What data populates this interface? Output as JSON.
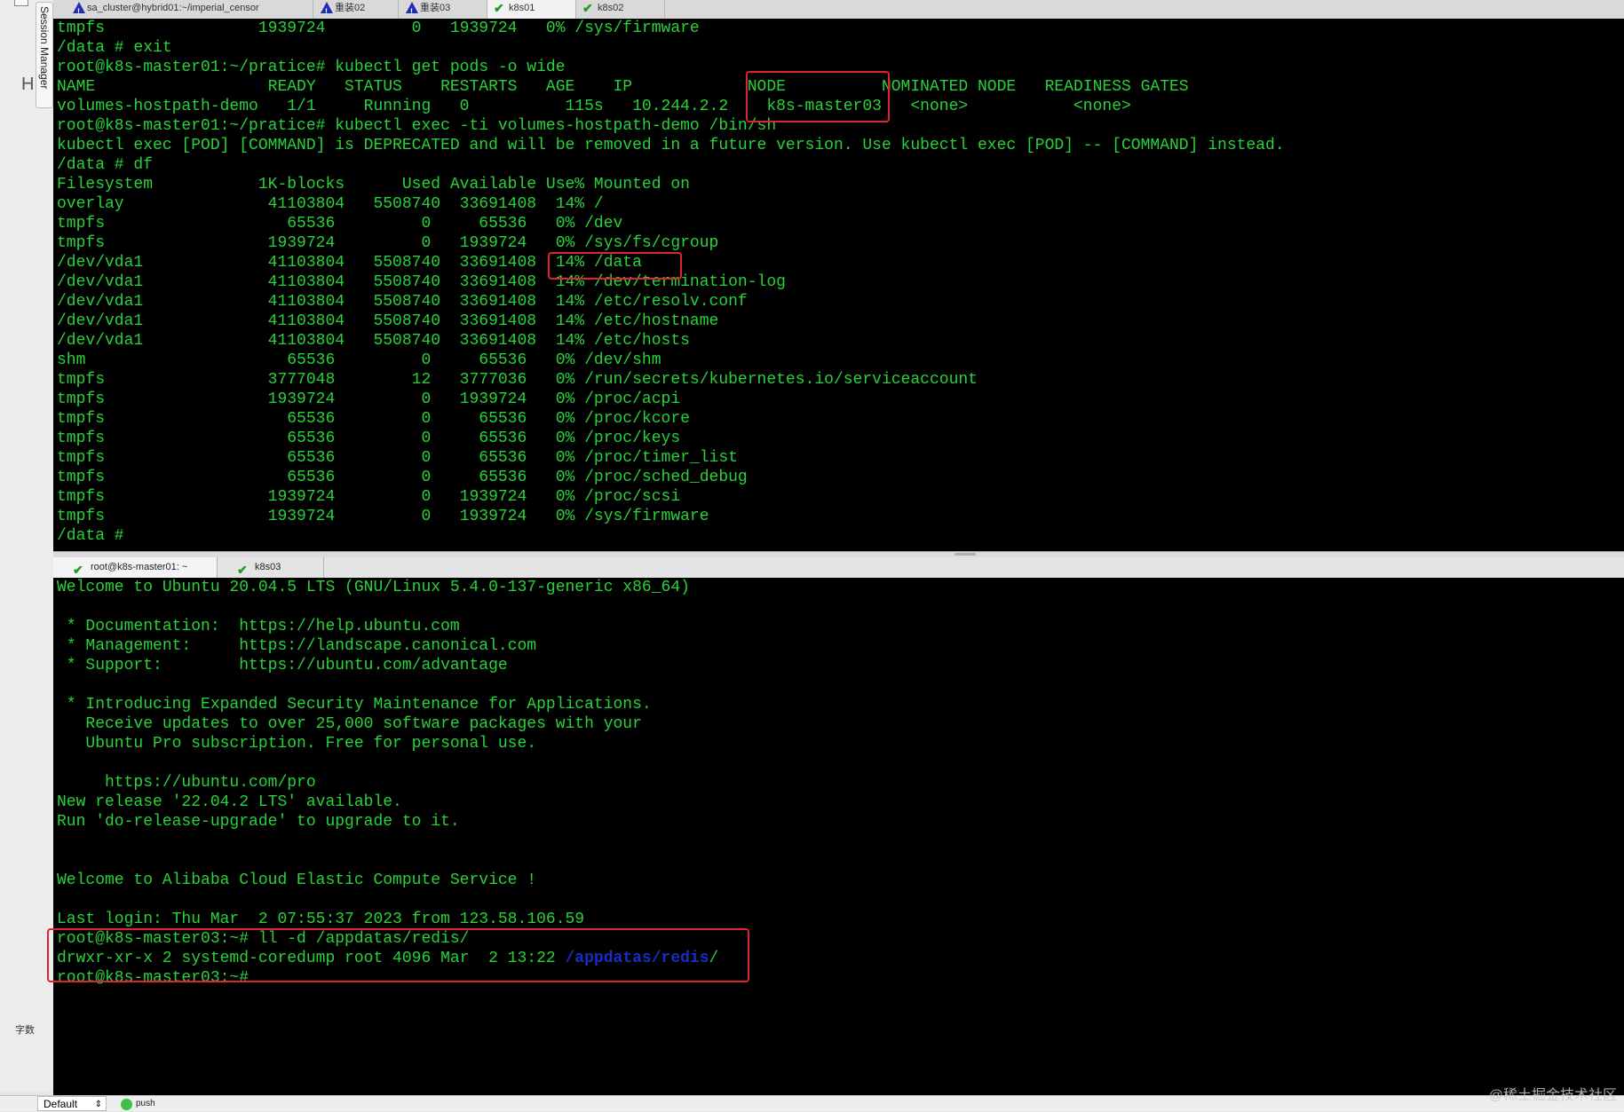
{
  "sidebar": {
    "session_manager_label": "Session Manager",
    "h_label": "H",
    "bottom_label": "字数"
  },
  "top_tabs": [
    {
      "label": "sa_cluster@hybrid01:~/imperial_censor",
      "icon": "warning-icon"
    },
    {
      "label": "重装02",
      "icon": "warning-icon"
    },
    {
      "label": "重装03",
      "icon": "warning-icon"
    },
    {
      "label": "k8s01",
      "icon": "check-icon"
    },
    {
      "label": "k8s02",
      "icon": "check-icon"
    }
  ],
  "terminal_top": {
    "lines": [
      "tmpfs                1939724         0   1939724   0% /sys/firmware",
      "/data # exit",
      "root@k8s-master01:~/pratice# kubectl get pods -o wide",
      "NAME                  READY   STATUS    RESTARTS   AGE    IP            NODE          NOMINATED NODE   READINESS GATES",
      "volumes-hostpath-demo   1/1     Running   0          115s   10.244.2.2    k8s-master03   <none>           <none>",
      "root@k8s-master01:~/pratice# kubectl exec -ti volumes-hostpath-demo /bin/sh",
      "kubectl exec [POD] [COMMAND] is DEPRECATED and will be removed in a future version. Use kubectl exec [POD] -- [COMMAND] instead.",
      "/data # df",
      "Filesystem           1K-blocks      Used Available Use% Mounted on",
      "overlay               41103804   5508740  33691408  14% /",
      "tmpfs                   65536         0     65536   0% /dev",
      "tmpfs                 1939724         0   1939724   0% /sys/fs/cgroup",
      "/dev/vda1             41103804   5508740  33691408  14% /data",
      "/dev/vda1             41103804   5508740  33691408  14% /dev/termination-log",
      "/dev/vda1             41103804   5508740  33691408  14% /etc/resolv.conf",
      "/dev/vda1             41103804   5508740  33691408  14% /etc/hostname",
      "/dev/vda1             41103804   5508740  33691408  14% /etc/hosts",
      "shm                     65536         0     65536   0% /dev/shm",
      "tmpfs                 3777048        12   3777036   0% /run/secrets/kubernetes.io/serviceaccount",
      "tmpfs                 1939724         0   1939724   0% /proc/acpi",
      "tmpfs                   65536         0     65536   0% /proc/kcore",
      "tmpfs                   65536         0     65536   0% /proc/keys",
      "tmpfs                   65536         0     65536   0% /proc/timer_list",
      "tmpfs                   65536         0     65536   0% /proc/sched_debug",
      "tmpfs                 1939724         0   1939724   0% /proc/scsi",
      "tmpfs                 1939724         0   1939724   0% /sys/firmware",
      "/data # "
    ]
  },
  "bottom_tabs": [
    {
      "label": "root@k8s-master01: ~",
      "icon": "check-icon"
    },
    {
      "label": "k8s03",
      "icon": "check-icon"
    }
  ],
  "terminal_bottom": {
    "lines": [
      "Welcome to Ubuntu 20.04.5 LTS (GNU/Linux 5.4.0-137-generic x86_64)",
      "",
      " * Documentation:  https://help.ubuntu.com",
      " * Management:     https://landscape.canonical.com",
      " * Support:        https://ubuntu.com/advantage",
      "",
      " * Introducing Expanded Security Maintenance for Applications.",
      "   Receive updates to over 25,000 software packages with your",
      "   Ubuntu Pro subscription. Free for personal use.",
      "",
      "     https://ubuntu.com/pro",
      "New release '22.04.2 LTS' available.",
      "Run 'do-release-upgrade' to upgrade to it.",
      "",
      "",
      "Welcome to Alibaba Cloud Elastic Compute Service !",
      "",
      "Last login: Thu Mar  2 07:55:37 2023 from 123.58.106.59",
      "root@k8s-master03:~# ll -d /appdatas/redis/"
    ],
    "ls_line_prefix": "drwxr-xr-x 2 systemd-coredump root 4096 Mar  2 13:22 ",
    "ls_line_dir": "/appdatas/redis",
    "ls_line_suffix": "/",
    "prompt_line": "root@k8s-master03:~#",
    "dir_color": "#1a2cc4",
    "text_color": "#29d13a",
    "highlight_color": "#e0232e"
  },
  "statusbar": {
    "profile_select": "Default",
    "push_label": "push",
    "watermark": "@稀土掘金技术社区"
  }
}
